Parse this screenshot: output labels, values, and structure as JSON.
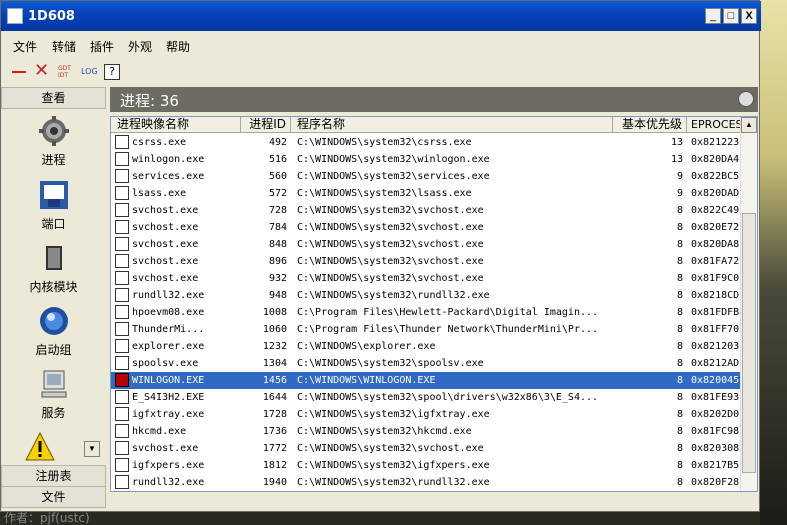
{
  "window": {
    "title": "1D608"
  },
  "title_buttons": {
    "minimize": "_",
    "maximize": "□",
    "close": "X"
  },
  "menu": [
    "文件",
    "转储",
    "插件",
    "外观",
    "帮助"
  ],
  "toolbar": {
    "gdt_line1": "GDT",
    "gdt_line2": "IDT",
    "log": "LOG",
    "help": "?"
  },
  "sidebar": {
    "top_header": "查看",
    "items": [
      "进程",
      "端口",
      "内核模块",
      "启动组",
      "服务"
    ],
    "bottom_headers": [
      "注册表",
      "文件"
    ]
  },
  "main": {
    "header": "进程: 36",
    "columns": [
      "进程映像名称",
      "进程ID",
      "程序名称",
      "基本优先级",
      "EPROCESS"
    ],
    "rows": [
      [
        "csrss.exe",
        "492",
        "C:\\WINDOWS\\system32\\csrss.exe",
        "13",
        "0x821223"
      ],
      [
        "winlogon.exe",
        "516",
        "C:\\WINDOWS\\system32\\winlogon.exe",
        "13",
        "0x820DA4"
      ],
      [
        "services.exe",
        "560",
        "C:\\WINDOWS\\system32\\services.exe",
        "9",
        "0x822BC5"
      ],
      [
        "lsass.exe",
        "572",
        "C:\\WINDOWS\\system32\\lsass.exe",
        "9",
        "0x820DAD"
      ],
      [
        "svchost.exe",
        "728",
        "C:\\WINDOWS\\system32\\svchost.exe",
        "8",
        "0x822C49"
      ],
      [
        "svchost.exe",
        "784",
        "C:\\WINDOWS\\system32\\svchost.exe",
        "8",
        "0x820E72"
      ],
      [
        "svchost.exe",
        "848",
        "C:\\WINDOWS\\system32\\svchost.exe",
        "8",
        "0x820DA8"
      ],
      [
        "svchost.exe",
        "896",
        "C:\\WINDOWS\\system32\\svchost.exe",
        "8",
        "0x81FA72"
      ],
      [
        "svchost.exe",
        "932",
        "C:\\WINDOWS\\system32\\svchost.exe",
        "8",
        "0x81F9C0"
      ],
      [
        "rundll32.exe",
        "948",
        "C:\\WINDOWS\\system32\\rundll32.exe",
        "8",
        "0x8218CD"
      ],
      [
        "hpoevm08.exe",
        "1008",
        "C:\\Program Files\\Hewlett-Packard\\Digital Imagin...",
        "8",
        "0x81FDFB"
      ],
      [
        "ThunderMi...",
        "1060",
        "C:\\Program Files\\Thunder Network\\ThunderMini\\Pr...",
        "8",
        "0x81FF70"
      ],
      [
        "explorer.exe",
        "1232",
        "C:\\WINDOWS\\explorer.exe",
        "8",
        "0x821203"
      ],
      [
        "spoolsv.exe",
        "1304",
        "C:\\WINDOWS\\system32\\spoolsv.exe",
        "8",
        "0x8212AD"
      ],
      [
        "WINLOGON.EXE",
        "1456",
        "C:\\WINDOWS\\WINLOGON.EXE",
        "8",
        "0x820045"
      ],
      [
        "E_S4I3H2.EXE",
        "1644",
        "C:\\WINDOWS\\system32\\spool\\drivers\\w32x86\\3\\E_S4...",
        "8",
        "0x81FE93"
      ],
      [
        "igfxtray.exe",
        "1728",
        "C:\\WINDOWS\\system32\\igfxtray.exe",
        "8",
        "0x8202D0"
      ],
      [
        "hkcmd.exe",
        "1736",
        "C:\\WINDOWS\\system32\\hkcmd.exe",
        "8",
        "0x81FC98"
      ],
      [
        "svchost.exe",
        "1772",
        "C:\\WINDOWS\\system32\\svchost.exe",
        "8",
        "0x820308"
      ],
      [
        "igfxpers.exe",
        "1812",
        "C:\\WINDOWS\\system32\\igfxpers.exe",
        "8",
        "0x8217B5"
      ],
      [
        "rundll32.exe",
        "1940",
        "C:\\WINDOWS\\system32\\rundll32.exe",
        "8",
        "0x820F28"
      ]
    ],
    "selected_row": 14
  },
  "status": "作者：pjf(ustc)",
  "colors": {
    "titlebar": "#0541b8",
    "selection": "#316ac5",
    "header_bar": "#6e6c62"
  }
}
